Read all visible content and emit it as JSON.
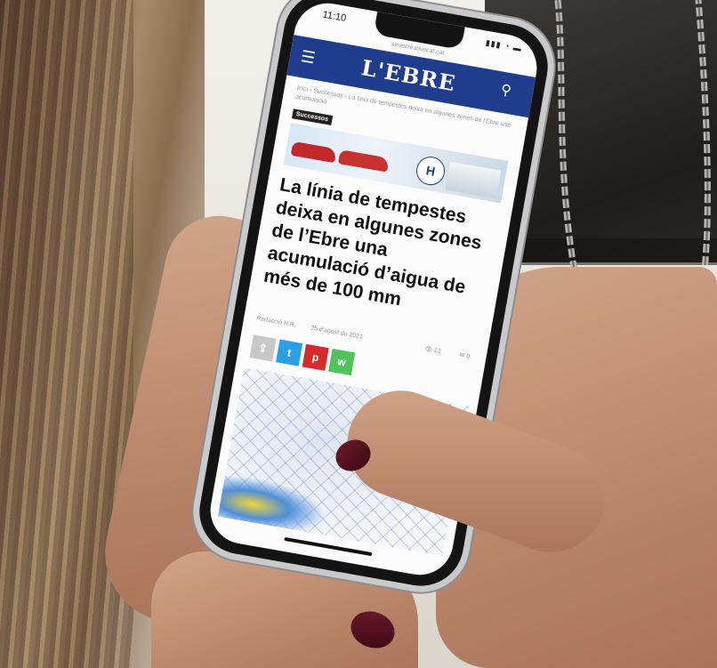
{
  "phone": {
    "status_time": "11:10",
    "status_icons": "▮▮▮ ◔ ▬",
    "url": "seuecreativecat.cat"
  },
  "site": {
    "logo": "L'EBRE",
    "breadcrumb": "Inici › Successos › La línia de tempestes deixa en algunes zones de l'Ebre una acumulació"
  },
  "article": {
    "category_badge": "Successos",
    "headline": "La línia de tempestes deixa en algunes zones de l’Ebre una acumulació d’aigua de més de 100 mm",
    "author": "Redacció N.R.",
    "date": "25 d'agost de 2021",
    "views": "👁 12",
    "comments": "✉ 0"
  },
  "ad": {
    "brand_mark": "H"
  },
  "share_buttons": {
    "twitter": "t",
    "pinterest": "p",
    "whatsapp": "w"
  },
  "colors": {
    "header_blue": "#1f3d8c",
    "twitter": "#2a9fe4",
    "pinterest": "#d72b2b",
    "whatsapp": "#4ec35a"
  },
  "icons": [
    "hamburger-menu-icon",
    "search-icon",
    "twitter-icon",
    "pinterest-icon",
    "whatsapp-icon",
    "share-icon"
  ]
}
